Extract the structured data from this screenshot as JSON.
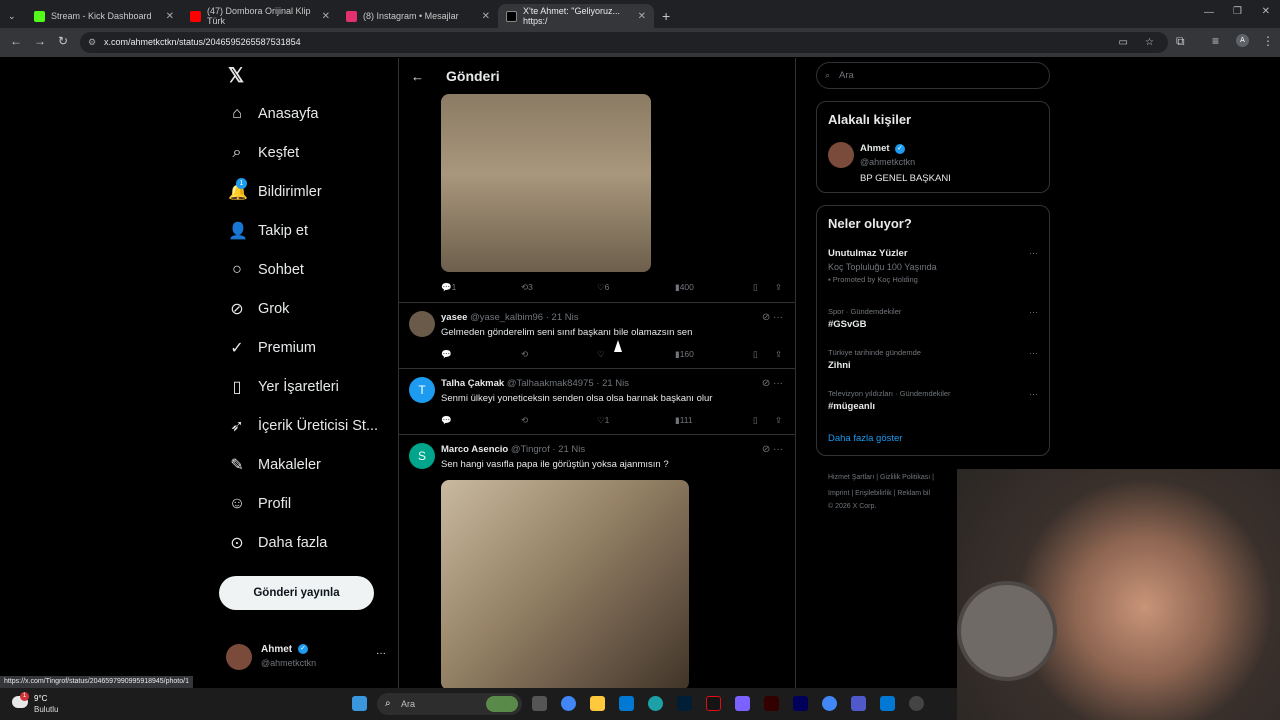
{
  "browser": {
    "tabs": [
      {
        "title": "Stream - Kick Dashboard",
        "color": "#53fc18"
      },
      {
        "title": "(47) Dombora Orijinal Klip Türk",
        "color": "#ff0000"
      },
      {
        "title": "(8) Instagram • Mesajlar",
        "color": "#e1306c"
      },
      {
        "title": "X'te Ahmet: \"Geliyoruz... https:/",
        "color": "#000000"
      }
    ],
    "url": "x.com/ahmetkctkn/status/2046595265587531854",
    "status_url": "https://x.com/Tingrof/status/2046597990995918945/photo/1"
  },
  "leftnav": {
    "items": [
      {
        "label": "Anasayfa",
        "icon": "home-icon"
      },
      {
        "label": "Keşfet",
        "icon": "search-icon"
      },
      {
        "label": "Bildirimler",
        "icon": "bell-icon"
      },
      {
        "label": "Takip et",
        "icon": "follow-icon"
      },
      {
        "label": "Sohbet",
        "icon": "chat-icon"
      },
      {
        "label": "Grok",
        "icon": "grok-icon"
      },
      {
        "label": "Premium",
        "icon": "premium-icon"
      },
      {
        "label": "Yer İşaretleri",
        "icon": "bookmark-icon"
      },
      {
        "label": "İçerik Üreticisi St...",
        "icon": "rocket-icon"
      },
      {
        "label": "Makaleler",
        "icon": "article-icon"
      },
      {
        "label": "Profil",
        "icon": "profile-icon"
      },
      {
        "label": "Daha fazla",
        "icon": "more-icon"
      }
    ],
    "notification_count": "1",
    "post_button": "Gönderi yayınla",
    "profile_name": "Ahmet",
    "profile_handle": "@ahmetkctkn"
  },
  "main": {
    "title": "Gönderi",
    "first_post_stats": {
      "replies": "1",
      "reposts": "3",
      "likes": "6",
      "views": "400"
    },
    "replies": [
      {
        "name": "yasee",
        "handle": "@yase_kalbim96",
        "time": "21 Nis",
        "text": "Gelmeden gönderelim seni sınıf başkanı bile olamazsın sen",
        "replies": "",
        "reposts": "",
        "likes": "",
        "views": "160",
        "avatar_color": "#6a5a4a",
        "initial": ""
      },
      {
        "name": "Talha Çakmak",
        "handle": "@Talhaakmak84975",
        "time": "21 Nis",
        "text": "Senmi ülkeyi yoneticeksin senden olsa olsa barınak başkanı olur",
        "replies": "",
        "reposts": "",
        "likes": "1",
        "views": "111",
        "avatar_color": "#1d9bf0",
        "initial": "T"
      },
      {
        "name": "Marco Asencio",
        "handle": "@Tingrof",
        "time": "21 Nis",
        "text": "Sen hangi vasıfla papa ile görüştün yoksa ajanmısın ?",
        "avatar_color": "#00a68c",
        "initial": "S"
      }
    ]
  },
  "right": {
    "search_placeholder": "Ara",
    "related_title": "Alakalı kişiler",
    "related_name": "Ahmet",
    "related_handle": "@ahmetkctkn",
    "related_bio": "BP GENEL BAŞKANI",
    "trends_title": "Neler oluyor?",
    "trends": [
      {
        "category": "",
        "title": "Unutulmaz Yüzler",
        "sub": "Koç Topluluğu 100 Yaşında",
        "promo": "Promoted by Koç Holding"
      },
      {
        "category": "Spor · Gündemdekiler",
        "title": "#GSvGB"
      },
      {
        "category": "Türkiye tarihinde gündemde",
        "title": "Zihni"
      },
      {
        "category": "Televizyon yıldızları · Gündemdekiler",
        "title": "#mügeanlı"
      }
    ],
    "show_more": "Daha fazla göster",
    "footer_line1": "Hizmet Şartları  |  Gizlilik Politikası  |",
    "footer_line2": "Imprint  |  Erişilebilirlik  |  Reklam bil",
    "footer_line3": "© 2026 X Corp."
  },
  "taskbar": {
    "weather_temp": "9°C",
    "weather_desc": "Bulutlu",
    "weather_badge": "1",
    "search_placeholder": "Ara"
  }
}
